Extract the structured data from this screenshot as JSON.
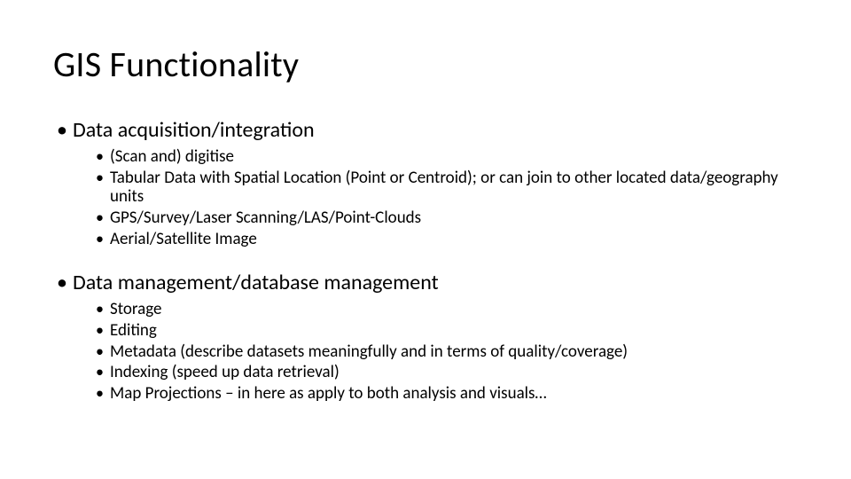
{
  "title": "GIS Functionality",
  "sections": [
    {
      "heading": "Data acquisition/integration",
      "items": [
        "(Scan and) digitise",
        "Tabular Data with Spatial Location (Point or Centroid); or can join to other located data/geography units",
        "GPS/Survey/Laser Scanning/LAS/Point-Clouds",
        "Aerial/Satellite Image"
      ]
    },
    {
      "heading": "Data management/database management",
      "items": [
        "Storage",
        "Editing",
        "Metadata (describe datasets meaningfully and in terms of quality/coverage)",
        "Indexing (speed up data retrieval)",
        "Map Projections – in here as apply to both analysis and visuals…"
      ]
    }
  ]
}
